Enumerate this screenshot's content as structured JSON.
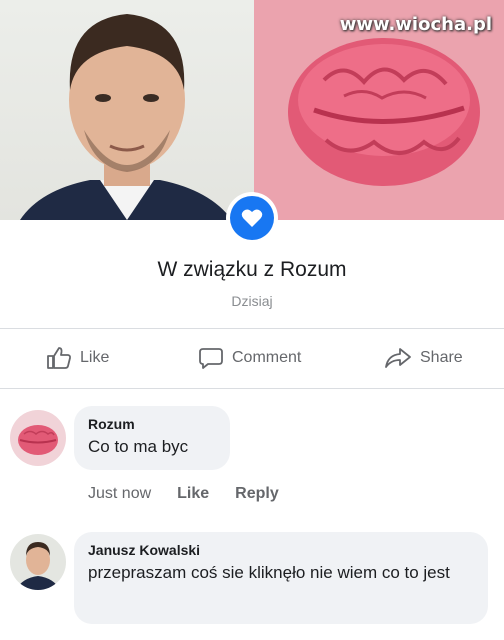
{
  "watermark": "www.wiocha.pl",
  "post": {
    "relationship_text": "W związku z Rozum",
    "date": "Dzisiaj"
  },
  "actions": {
    "like": "Like",
    "comment": "Comment",
    "share": "Share"
  },
  "comments": [
    {
      "author": "Rozum",
      "text": "Co to ma byc",
      "time": "Just now",
      "like": "Like",
      "reply": "Reply"
    },
    {
      "author": "Janusz Kowalski",
      "text": "przepraszam coś sie kliknęło nie wiem co to jest"
    }
  ],
  "colors": {
    "accent": "#1877f2",
    "bubble": "#f0f2f5",
    "muted": "#65676b",
    "brain_bg": "#eba3ae"
  },
  "icons": {
    "heart": "heart-icon",
    "like": "thumbs-up-icon",
    "comment": "speech-bubble-icon",
    "share": "share-arrow-icon"
  }
}
